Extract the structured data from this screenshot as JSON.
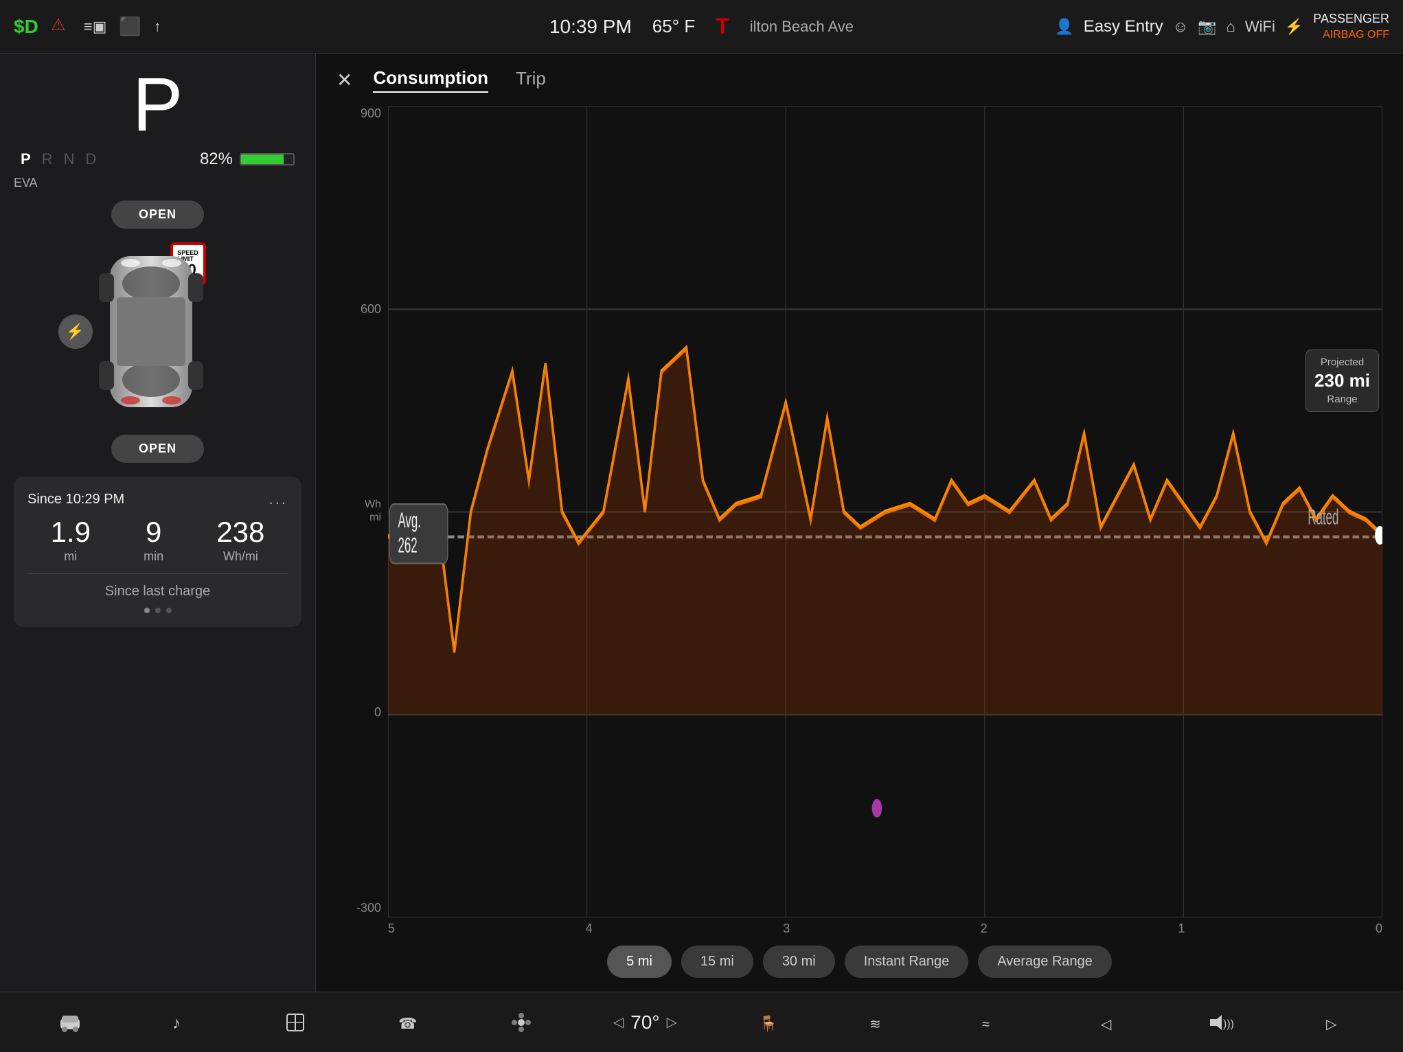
{
  "statusBar": {
    "leftIcons": [
      "$D",
      "⚠"
    ],
    "centerIcons": [
      "≡▣",
      "⬛D",
      "↑"
    ],
    "time": "10:39 PM",
    "temp": "65° F",
    "teslaLogo": "T",
    "roadText": "ilton Beach Ave",
    "easyEntry": "Easy Entry",
    "passengerAirbag": "PASSENGER",
    "airbagStatus": "AIRBAG OFF"
  },
  "leftPanel": {
    "gear": "P",
    "prnd": [
      "P",
      "R",
      "N",
      "D"
    ],
    "activeGear": "P",
    "batteryPct": "82%",
    "evaLabel": "EVA",
    "doorBtnTop": "OPEN",
    "doorBtnBottom": "OPEN",
    "speedLimit": "30",
    "speedLimitLabel": "SPEED LIMIT",
    "chargeIcon": "⚡",
    "statsPanel": {
      "sinceLabel": "Since 10:29 PM",
      "menuDots": "...",
      "stats": [
        {
          "value": "1.9",
          "unit": "mi"
        },
        {
          "value": "9",
          "unit": "min"
        },
        {
          "value": "238",
          "unit": "Wh/mi"
        }
      ],
      "sinceLastCharge": "Since last charge"
    }
  },
  "rightPanel": {
    "closeBtn": "✕",
    "tabs": [
      {
        "label": "Consumption",
        "active": true
      },
      {
        "label": "Trip",
        "active": false
      }
    ],
    "yAxisLabels": [
      "900",
      "600",
      "Wh\nmi",
      "0",
      "-300"
    ],
    "yAxisValues": [
      900,
      600,
      300,
      0,
      -300
    ],
    "xAxisLabels": [
      "5",
      "4",
      "3",
      "2",
      "1",
      "0"
    ],
    "avgLabel": "Avg.\n262",
    "avgValue": 262,
    "ratedLabel": "Rated",
    "projected": {
      "title": "Projected",
      "value": "230 mi",
      "subtitle": "Range"
    },
    "buttons": [
      {
        "label": "5 mi",
        "active": true
      },
      {
        "label": "15 mi",
        "active": false
      },
      {
        "label": "30 mi",
        "active": false
      },
      {
        "label": "Instant Range",
        "active": false
      },
      {
        "label": "Average Range",
        "active": false
      }
    ]
  },
  "taskbar": {
    "icons": [
      "🚗",
      "♪",
      "⬆",
      "☎",
      "❄",
      "70°",
      "🪑",
      "~",
      "≈",
      "◁",
      "🔊",
      "▷"
    ]
  }
}
